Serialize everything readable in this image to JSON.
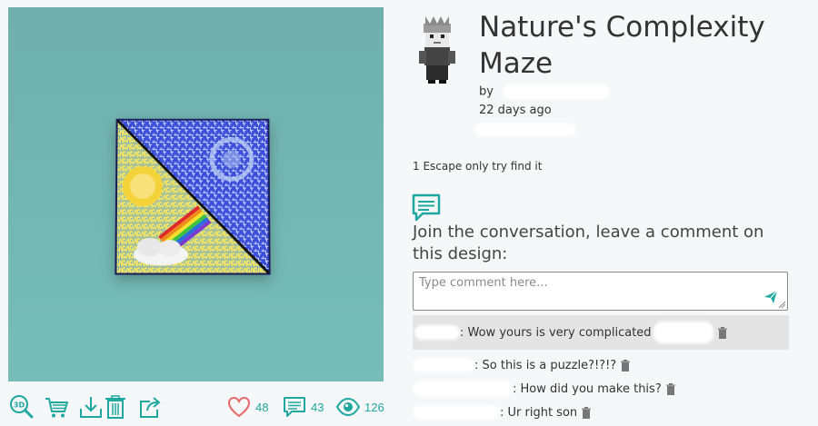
{
  "design": {
    "title": "Nature's Complexity Maze",
    "by_label": "by",
    "age": "22 days ago",
    "description": "1 Escape only try find it"
  },
  "conversation": {
    "prompt": "Join the conversation, leave a comment on this design:",
    "placeholder": "Type comment here..."
  },
  "comments": [
    {
      "text": ": Wow yours is very complicated"
    },
    {
      "text": ": So this is a puzzle?!?!?"
    },
    {
      "text": ": How did you make this?"
    },
    {
      "text": ": Ur right son"
    }
  ],
  "stats": {
    "likes": "48",
    "comments": "43",
    "views": "126"
  },
  "icons": {
    "actions": [
      "zoom-3d-icon",
      "cart-icon",
      "download-icon",
      "trash-icon",
      "share-icon"
    ],
    "stats": [
      "heart-icon",
      "comment-icon",
      "eye-icon"
    ]
  },
  "colors": {
    "accent": "#1fa8a0",
    "heart": "#e56b6b",
    "preview_bg": "#72b5b0",
    "comment_highlight": "#e4e4e4"
  }
}
